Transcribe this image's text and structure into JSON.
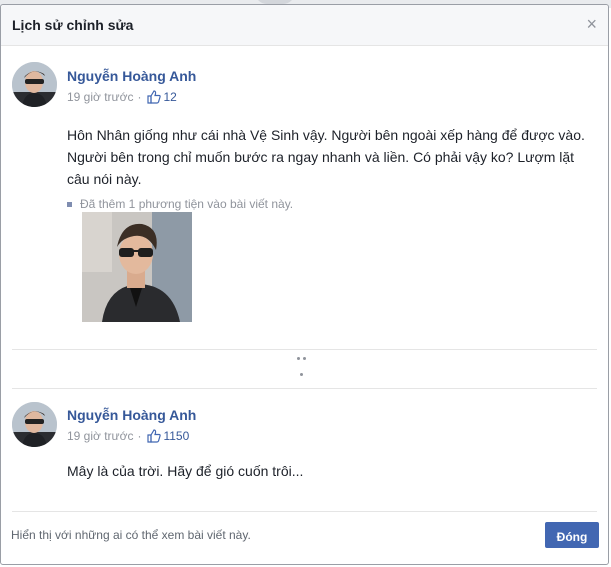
{
  "dialog": {
    "title": "Lịch sử chỉnh sửa",
    "close_icon": "×"
  },
  "posts": [
    {
      "author": "Nguyễn Hoàng Anh",
      "time": "19 giờ trước",
      "separator": "·",
      "likes": "12",
      "text": "Hôn Nhân giống như cái nhà Vệ Sinh vậy. Người bên ngoài xếp hàng để được vào. Người bên trong chỉ muốn bước ra ngay nhanh và liền. Có phải vậy ko? Lượm lặt câu nói này.",
      "media_note": "Đã thêm 1 phương tiện vào bài viết này."
    },
    {
      "author": "Nguyễn Hoàng Anh",
      "time": "19 giờ trước",
      "separator": "·",
      "likes": "1150",
      "text": "Mây là của trời. Hãy để gió cuốn trôi..."
    }
  ],
  "footer": {
    "visibility_text": "Hiển thị với những ai có thể xem bài viết này.",
    "close_button": "Đóng"
  },
  "colors": {
    "link": "#365899",
    "button": "#4267b2",
    "meta": "#90949c"
  }
}
